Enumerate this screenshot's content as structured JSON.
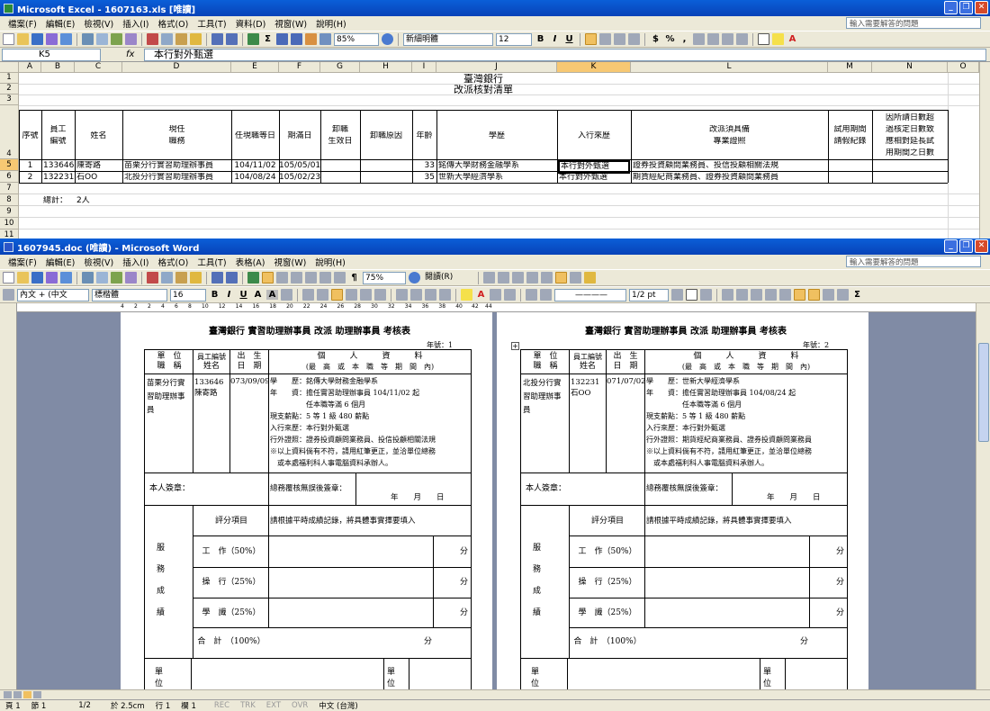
{
  "excel": {
    "title": "Microsoft Excel - 1607163.xls  [唯讀]",
    "menu": [
      "檔案(F)",
      "編輯(E)",
      "檢視(V)",
      "插入(I)",
      "格式(O)",
      "工具(T)",
      "資料(D)",
      "視窗(W)",
      "說明(H)"
    ],
    "help_placeholder": "輸入需要解答的問題",
    "zoom": "85%",
    "font": "新細明體",
    "font_size": "12",
    "name_box": "K5",
    "formula_label": "fx",
    "formula": "本行對外甄選",
    "columns": [
      "A",
      "B",
      "C",
      "D",
      "E",
      "F",
      "G",
      "H",
      "I",
      "J",
      "K",
      "L",
      "M",
      "N",
      "O"
    ],
    "rows": [
      "1",
      "2",
      "3",
      "4",
      "5",
      "6",
      "7",
      "8",
      "9",
      "10",
      "11"
    ],
    "sheet_title": "臺灣銀行",
    "sheet_subtitle": "改派核對清單",
    "headers": {
      "seq": "序號",
      "emp_no_1": "員工",
      "emp_no_2": "編號",
      "name": "姓名",
      "position_1": "現任",
      "position_2": "職務",
      "date_hired": "任現職等日",
      "due_date": "期滿日",
      "effective_1": "卸職",
      "effective_2": "生效日",
      "reason": "卸職原因",
      "age": "年齡",
      "education": "學歷",
      "source": "入行來歷",
      "skills_1": "改派須具備",
      "skills_2": "專業證照",
      "trial_1": "試用期間",
      "trial_2": "請假紀錄",
      "leave_1": "因所請日數超",
      "leave_2": "過核定日數致",
      "leave_3": "應相對延長試",
      "leave_4": "用期間之日數"
    },
    "records": [
      {
        "seq": "1",
        "emp_no": "133646",
        "name": "陳寄路",
        "position": "苗栗分行實習助理辦事員",
        "date_hired": "104/11/02",
        "due_date": "105/05/01",
        "age": "33",
        "education": "銘傳大學財務金融學系",
        "source": "本行對外甄選",
        "skills": "證券投資顧問業務員、投信投顧相關法規"
      },
      {
        "seq": "2",
        "emp_no": "132231",
        "name": "石OO",
        "position": "北投分行實習助理辦事員",
        "date_hired": "104/08/24",
        "due_date": "105/02/23",
        "age": "35",
        "education": "世新大學經濟學系",
        "source": "本行對外甄選",
        "skills": "期貨經紀商業務員、證券投資顧問業務員"
      }
    ],
    "total_label": "總計：",
    "total_value": "2人"
  },
  "word": {
    "title": "1607945.doc (唯讀) - Microsoft Word",
    "menu": [
      "檔案(F)",
      "編輯(E)",
      "檢視(V)",
      "插入(I)",
      "格式(O)",
      "工具(T)",
      "表格(A)",
      "視窗(W)",
      "說明(H)"
    ],
    "help_placeholder": "輸入需要解答的問題",
    "zoom": "75%",
    "reading": "閱讀(R)",
    "style": "內文 + (中文",
    "font": "標楷體",
    "font_size": "16",
    "line": "1/2 pt",
    "ruler_left": [
      "4",
      "2",
      "2",
      "4",
      "6",
      "8",
      "10",
      "12",
      "14",
      "16",
      "18",
      "20",
      "22",
      "24",
      "26",
      "28",
      "30",
      "32",
      "34",
      "36",
      "38",
      "40"
    ],
    "ruler_right_a": "42",
    "ruler_right_b": "44",
    "pages": [
      {
        "heading": "臺灣銀行 實習助理辦事員 改派 助理辦事員 考核表",
        "page_no": "年號：1",
        "h_unit_1": "單　位",
        "h_unit_2": "職　稱",
        "h_emp_1": "員工編號",
        "h_emp_2": "姓名",
        "h_birth_1": "出　生",
        "h_birth_2": "日　期",
        "h_info_1": "個　　　人　　　資　　　料",
        "h_info_2": "(最　高　或　本　職　等　期　間　內)",
        "unit": "苗栗分行實習助理辦事員",
        "emp": "133646 陳寄路",
        "birth": "073/09/09",
        "info": [
          "學　　歷：銘傳大學財務金融學系",
          "年　　資：擔任實習助理辦事員 104/11/02 起",
          "　　　　　任本職等滿 6 個月",
          "現支薪點：5 等 1 級 480 薪點",
          "入行來歷：本行對外甄選",
          "行外證照：證券投資顧問業務員、投信投顧相關法規",
          "※以上資料倘有不符，請用紅筆更正，並洽單位總務",
          "　或本處福利科人事電腦資料承辦人。"
        ],
        "sign_self": "本人簽章：",
        "sign_admin": "總務覆核無誤後簽章：",
        "date_line": "年　　月　　日",
        "eval_label": "服務成績",
        "eval_item": "評分項目",
        "eval_note": "請根據平時成績記錄，將具體事實擇要填入",
        "items": [
          "工　作（50%）",
          "操　行（25%）",
          "學　識（25%）"
        ],
        "score_unit": "分",
        "total": "合　計　（100%）",
        "bottom_label": "單　位"
      },
      {
        "heading": "臺灣銀行 實習助理辦事員 改派 助理辦事員 考核表",
        "page_no": "年號：2",
        "h_unit_1": "單　位",
        "h_unit_2": "職　稱",
        "h_emp_1": "員工編號",
        "h_emp_2": "姓名",
        "h_birth_1": "出　生",
        "h_birth_2": "日　期",
        "h_info_1": "個　　　人　　　資　　　料",
        "h_info_2": "(最　高　或　本　職　等　期　間　內)",
        "unit": "北投分行實習助理辦事員",
        "emp": "132231 石OO",
        "birth": "071/07/02",
        "info": [
          "學　　歷：世新大學經濟學系",
          "年　　資：擔任實習助理辦事員 104/08/24 起",
          "　　　　　任本職等滿 6 個月",
          "現支薪點：5 等 1 級 480 薪點",
          "入行來歷：本行對外甄選",
          "行外證照：期貨經紀商業務員、證券投資顧問業務員",
          "※以上資料倘有不符，請用紅筆更正，並洽單位總務",
          "　或本處福利科人事電腦資料承辦人。"
        ],
        "sign_self": "本人簽章：",
        "sign_admin": "總務覆核無誤後簽章：",
        "date_line": "年　　月　　日",
        "eval_label": "服務成績",
        "eval_item": "評分項目",
        "eval_note": "請根據平時成績記錄，將具體事實擇要填入",
        "items": [
          "工　作（50%）",
          "操　行（25%）",
          "學　識（25%）"
        ],
        "score_unit": "分",
        "total": "合　計　（100%）",
        "bottom_label": "單　位"
      }
    ],
    "status": [
      "頁 1",
      "節 1",
      "1/2",
      "於 2.5cm",
      "行 1",
      "欄 1",
      "REC",
      "TRK",
      "EXT",
      "OVR",
      "中文 (台灣)"
    ]
  }
}
